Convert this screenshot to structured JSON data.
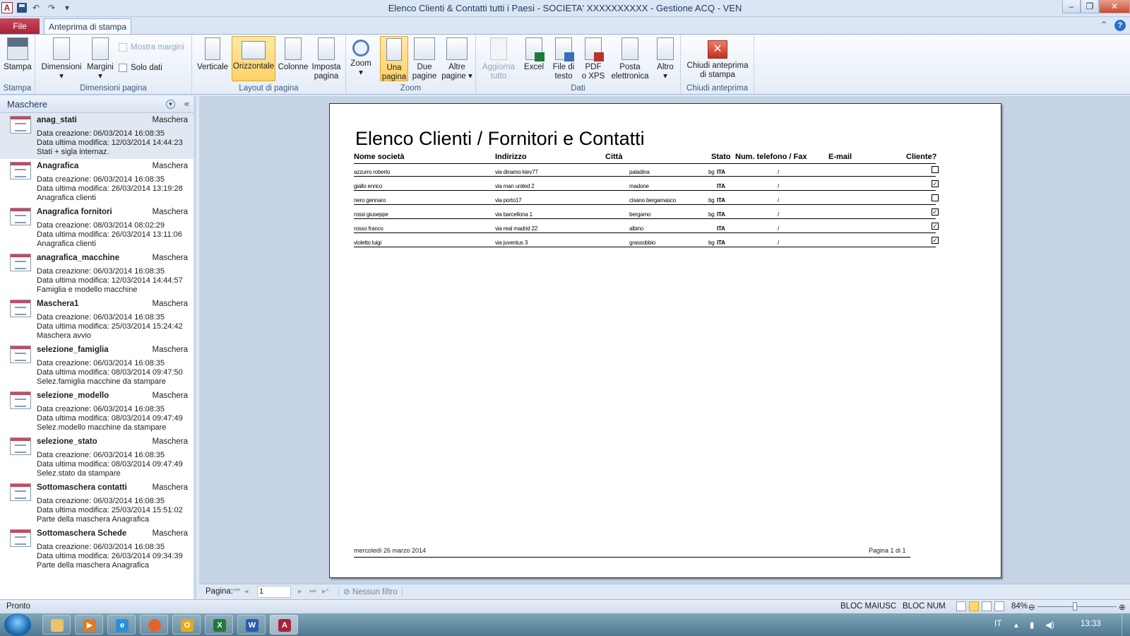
{
  "app": {
    "icon_letter": "A",
    "window_title": "Elenco Clienti & Contatti tutti i Paesi  -  SOCIETA' XXXXXXXXXX - Gestione ACQ - VEN"
  },
  "ribbon_tabs": {
    "file": "File",
    "active": "Anteprima di stampa"
  },
  "ribbon": {
    "stampa": {
      "button": "Stampa",
      "group": "Stampa"
    },
    "dimensioni": {
      "dimensioni": "Dimensioni",
      "margini": "Margini",
      "mostra_margini": "Mostra margini",
      "solo_dati": "Solo dati",
      "group": "Dimensioni pagina"
    },
    "layout": {
      "verticale": "Verticale",
      "orizzontale": "Orizzontale",
      "colonne": "Colonne",
      "imposta_1": "Imposta",
      "imposta_2": "pagina",
      "group": "Layout di pagina"
    },
    "zoom": {
      "zoom": "Zoom",
      "una_1": "Una",
      "una_2": "pagina",
      "due_1": "Due",
      "due_2": "pagine",
      "altre_1": "Altre",
      "altre_2": "pagine",
      "group": "Zoom"
    },
    "dati": {
      "aggiorna_1": "Aggiorna",
      "aggiorna_2": "tutto",
      "excel": "Excel",
      "file_1": "File di",
      "file_2": "testo",
      "pdf_1": "PDF",
      "pdf_2": "o XPS",
      "posta_1": "Posta",
      "posta_2": "elettronica",
      "altro": "Altro",
      "group": "Dati"
    },
    "chiudi": {
      "btn_1": "Chiudi anteprima",
      "btn_2": "di stampa",
      "group": "Chiudi anteprima"
    }
  },
  "nav": {
    "title": "Maschere",
    "labels": {
      "created": "Data creazione:",
      "modified": "Data ultima modifica:"
    },
    "items": [
      {
        "name": "anag_stati",
        "type": "Maschera",
        "created": "06/03/2014 16:08:35",
        "modified": "12/03/2014 14:44:23",
        "desc": "Stati + sigla internaz."
      },
      {
        "name": "Anagrafica",
        "type": "Maschera",
        "created": "06/03/2014 16:08:35",
        "modified": "26/03/2014 13:19:28",
        "desc": "Anagrafica clienti"
      },
      {
        "name": "Anagrafica fornitori",
        "type": "Maschera",
        "created": "08/03/2014 08:02:29",
        "modified": "26/03/2014 13:11:06",
        "desc": "Anagrafica clienti"
      },
      {
        "name": "anagrafica_macchine",
        "type": "Maschera",
        "created": "06/03/2014 16:08:35",
        "modified": "12/03/2014 14:44:57",
        "desc": "Famiglia e modello macchine"
      },
      {
        "name": "Maschera1",
        "type": "Maschera",
        "created": "06/03/2014 16:08:35",
        "modified": "25/03/2014 15:24:42",
        "desc": "Maschera avvio"
      },
      {
        "name": "selezione_famiglia",
        "type": "Maschera",
        "created": "06/03/2014 16:08:35",
        "modified": "08/03/2014 09:47:50",
        "desc": "Selez.famiglia macchine da stampare"
      },
      {
        "name": "selezione_modello",
        "type": "Maschera",
        "created": "06/03/2014 16:08:35",
        "modified": "08/03/2014 09:47:49",
        "desc": "Selez.modello macchine da stampare"
      },
      {
        "name": "selezione_stato",
        "type": "Maschera",
        "created": "06/03/2014 16:08:35",
        "modified": "08/03/2014 09:47:49",
        "desc": "Selez.stato da stampare"
      },
      {
        "name": "Sottomaschera contatti",
        "type": "Maschera",
        "created": "06/03/2014 16:08:35",
        "modified": "25/03/2014 15:51:02",
        "desc": "Parte della maschera Anagrafica"
      },
      {
        "name": "Sottomaschera Schede",
        "type": "Maschera",
        "created": "06/03/2014 16:08:35",
        "modified": "26/03/2014 09:34:39",
        "desc": "Parte della maschera Anagrafica"
      }
    ]
  },
  "report": {
    "title": "Elenco Clienti / Fornitori e Contatti",
    "headers": {
      "nome": "Nome società",
      "indirizzo": "Indirizzo",
      "citta": "Città",
      "stato": "Stato",
      "telefono": "Num. telefono / Fax",
      "email": "E-mail",
      "cliente": "Cliente?"
    },
    "rows": [
      {
        "nome": "azzurro roberto",
        "indirizzo": "via dinamo kiev77",
        "citta": "paladina",
        "prov": "bg",
        "stato": "ITA",
        "telefono": "/",
        "cliente": false
      },
      {
        "nome": "giallo enrico",
        "indirizzo": "via man united 2",
        "citta": "madone",
        "prov": "",
        "stato": "ITA",
        "telefono": "/",
        "cliente": true
      },
      {
        "nome": "nero gennaro",
        "indirizzo": "via porto17",
        "citta": "cisano bergamasco",
        "prov": "bg",
        "stato": "ITA",
        "telefono": "/",
        "cliente": false
      },
      {
        "nome": "rossi giuseppe",
        "indirizzo": "via barcellona 1",
        "citta": "bergamo",
        "prov": "bg",
        "stato": "ITA",
        "telefono": "/",
        "cliente": true
      },
      {
        "nome": "rosso franco",
        "indirizzo": "via real madrid 22",
        "citta": "albino",
        "prov": "",
        "stato": "ITA",
        "telefono": "/",
        "cliente": true
      },
      {
        "nome": "violetto luigi",
        "indirizzo": "via juventus 3",
        "citta": "grassobbio",
        "prov": "bg",
        "stato": "ITA",
        "telefono": "/",
        "cliente": true
      }
    ],
    "footer_date": "mercoledì 26 marzo 2014",
    "footer_page": "Pagina 1 di 1"
  },
  "record_nav": {
    "label": "Pagina:",
    "page_value": "1",
    "filter": "Nessun filtro"
  },
  "status": {
    "left": "Pronto",
    "caps": "BLOC MAIUSC",
    "num": "BLOC NUM",
    "zoom": "84%",
    "zoom_fraction": 0.84
  },
  "taskbar": {
    "lang": "IT",
    "time": "13:33"
  }
}
